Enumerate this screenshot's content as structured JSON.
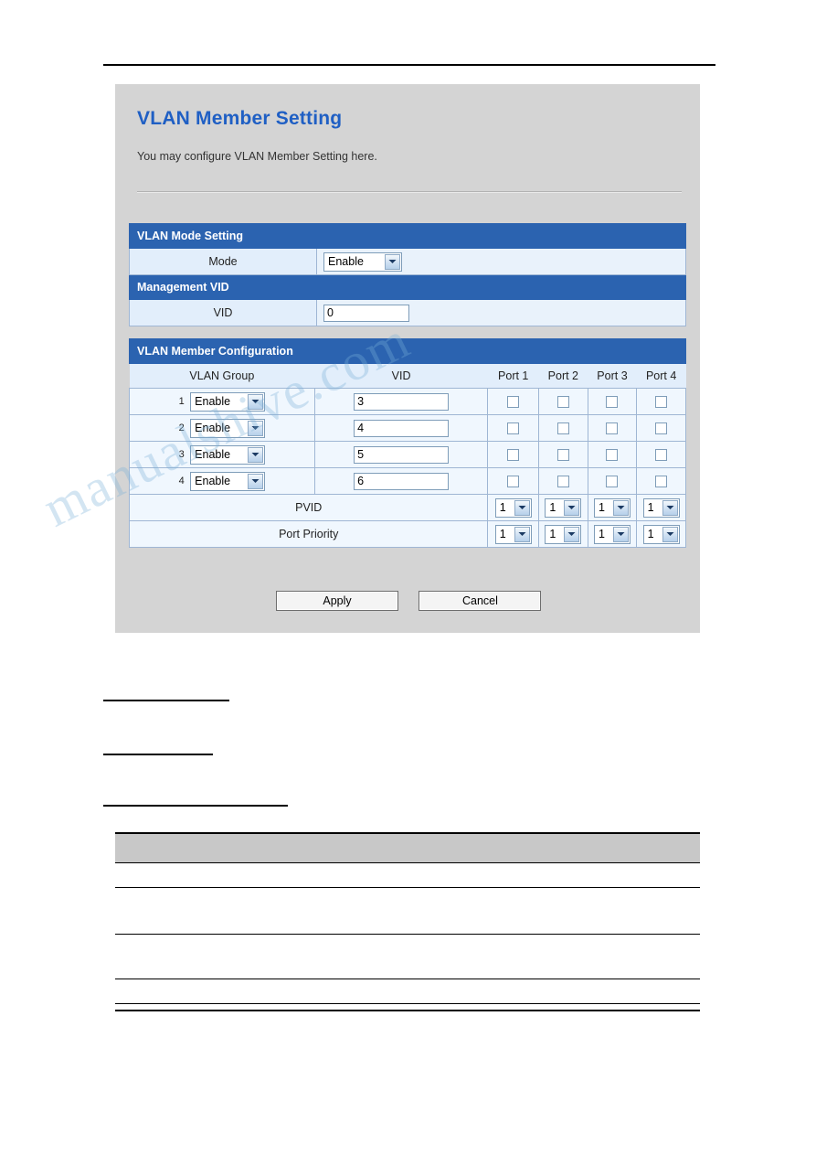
{
  "panel": {
    "title": "VLAN Member Setting",
    "subtitle": "You may configure VLAN Member Setting here.",
    "sections": {
      "mode_setting": "VLAN Mode Setting",
      "management_vid": "Management VID",
      "member_configuration": "VLAN Member Configuration"
    },
    "mode": {
      "label": "Mode",
      "value": "Enable"
    },
    "management": {
      "label": "VID",
      "value": "0"
    },
    "table": {
      "headers": [
        "VLAN Group",
        "VID",
        "Port 1",
        "Port 2",
        "Port 3",
        "Port 4"
      ],
      "rows": [
        {
          "index": "1",
          "group": "Enable",
          "vid": "3",
          "ports": [
            false,
            false,
            false,
            false
          ]
        },
        {
          "index": "2",
          "group": "Enable",
          "vid": "4",
          "ports": [
            false,
            false,
            false,
            false
          ]
        },
        {
          "index": "3",
          "group": "Enable",
          "vid": "5",
          "ports": [
            false,
            false,
            false,
            false
          ]
        },
        {
          "index": "4",
          "group": "Enable",
          "vid": "6",
          "ports": [
            false,
            false,
            false,
            false
          ]
        }
      ],
      "pvid": {
        "label": "PVID",
        "values": [
          "1",
          "1",
          "1",
          "1"
        ]
      },
      "port_priority": {
        "label": "Port Priority",
        "values": [
          "1",
          "1",
          "1",
          "1"
        ]
      }
    },
    "buttons": {
      "apply": "Apply",
      "cancel": "Cancel"
    }
  },
  "watermark": "manualshive.com"
}
